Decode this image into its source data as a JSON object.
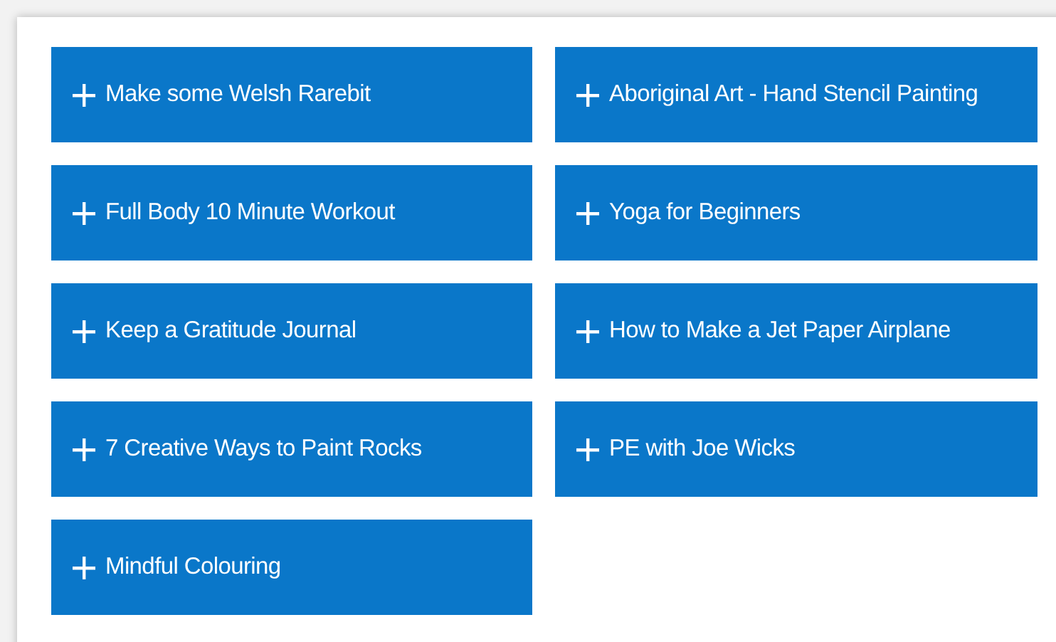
{
  "accordion_items": [
    {
      "label": "Make some Welsh Rarebit",
      "expanded": false
    },
    {
      "label": "Aboriginal Art - Hand Stencil Painting",
      "expanded": false
    },
    {
      "label": "Full Body 10 Minute Workout",
      "expanded": false
    },
    {
      "label": "Yoga for Beginners",
      "expanded": false
    },
    {
      "label": "Keep a Gratitude Journal",
      "expanded": false
    },
    {
      "label": "How to Make a Jet Paper Airplane",
      "expanded": false
    },
    {
      "label": "7 Creative Ways to Paint Rocks",
      "expanded": false
    },
    {
      "label": "PE with Joe Wicks",
      "expanded": false
    },
    {
      "label": "Mindful Colouring",
      "expanded": false
    }
  ]
}
